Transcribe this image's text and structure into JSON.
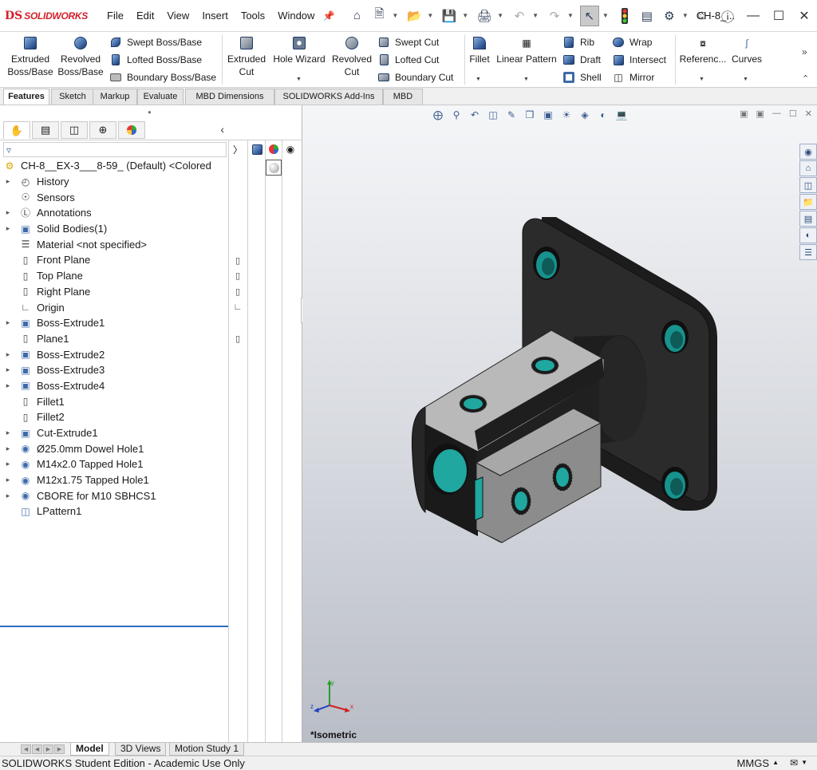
{
  "app": {
    "brand_prefix": "DS",
    "brand": "SOLIDWORKS",
    "doc_title": "CH-8_..."
  },
  "menu": [
    "File",
    "Edit",
    "View",
    "Insert",
    "Tools",
    "Window"
  ],
  "ribbon": {
    "extruded_boss": "Extruded\nBoss/Base",
    "revolved_boss": "Revolved\nBoss/Base",
    "swept_boss": "Swept Boss/Base",
    "lofted_boss": "Lofted Boss/Base",
    "boundary_boss": "Boundary Boss/Base",
    "extruded_cut": "Extruded\nCut",
    "hole_wizard": "Hole Wizard",
    "revolved_cut": "Revolved\nCut",
    "swept_cut": "Swept Cut",
    "lofted_cut": "Lofted Cut",
    "boundary_cut": "Boundary Cut",
    "fillet": "Fillet",
    "linear_pattern": "Linear Pattern",
    "rib": "Rib",
    "draft": "Draft",
    "shell": "Shell",
    "wrap": "Wrap",
    "intersect": "Intersect",
    "mirror": "Mirror",
    "reference": "Referenc...",
    "curves": "Curves"
  },
  "tabs": [
    "Features",
    "Sketch",
    "Markup",
    "Evaluate",
    "MBD Dimensions",
    "SOLIDWORKS Add-Ins",
    "MBD"
  ],
  "tree": {
    "root": "CH-8__EX-3___8-59_ (Default) <Colored",
    "items": [
      {
        "label": "History",
        "icon": "history-icon",
        "exp": true
      },
      {
        "label": "Sensors",
        "icon": "sensors-icon",
        "exp": false
      },
      {
        "label": "Annotations",
        "icon": "annotations-icon",
        "exp": true
      },
      {
        "label": "Solid Bodies(1)",
        "icon": "solid-bodies-icon",
        "exp": true
      },
      {
        "label": "Material <not specified>",
        "icon": "material-icon",
        "exp": false
      },
      {
        "label": "Front Plane",
        "icon": "plane-icon",
        "exp": false
      },
      {
        "label": "Top Plane",
        "icon": "plane-icon",
        "exp": false
      },
      {
        "label": "Right Plane",
        "icon": "plane-icon",
        "exp": false
      },
      {
        "label": "Origin",
        "icon": "origin-icon",
        "exp": false
      },
      {
        "label": "Boss-Extrude1",
        "icon": "extrude-icon",
        "exp": true
      },
      {
        "label": "Plane1",
        "icon": "plane-icon",
        "exp": false
      },
      {
        "label": "Boss-Extrude2",
        "icon": "extrude-icon",
        "exp": true
      },
      {
        "label": "Boss-Extrude3",
        "icon": "extrude-icon",
        "exp": true
      },
      {
        "label": "Boss-Extrude4",
        "icon": "extrude-icon",
        "exp": true
      },
      {
        "label": "Fillet1",
        "icon": "fillet-icon",
        "exp": false
      },
      {
        "label": "Fillet2",
        "icon": "fillet-icon",
        "exp": false
      },
      {
        "label": "Cut-Extrude1",
        "icon": "cut-extrude-icon",
        "exp": true
      },
      {
        "label": "Ø25.0mm Dowel Hole1",
        "icon": "hole-icon",
        "exp": true
      },
      {
        "label": "M14x2.0 Tapped Hole1",
        "icon": "hole-icon",
        "exp": true
      },
      {
        "label": "M12x1.75 Tapped Hole1",
        "icon": "hole-icon",
        "exp": true
      },
      {
        "label": "CBORE for M10 SBHCS1",
        "icon": "hole-icon",
        "exp": true
      },
      {
        "label": "LPattern1",
        "icon": "pattern-icon",
        "exp": false
      }
    ]
  },
  "viewport": {
    "view_label": "*Isometric",
    "axis_x": "x",
    "axis_y": "y",
    "axis_z": "z"
  },
  "bottom_tabs": [
    "Model",
    "3D Views",
    "Motion Study 1"
  ],
  "status": {
    "text": "SOLIDWORKS Student Edition - Academic Use Only",
    "units": "MMGS"
  },
  "colors": {
    "brand": "#d4202a",
    "body": "#2a2a2a",
    "hole_teal": "#1fa7a0",
    "block": "#9a9a9a"
  }
}
